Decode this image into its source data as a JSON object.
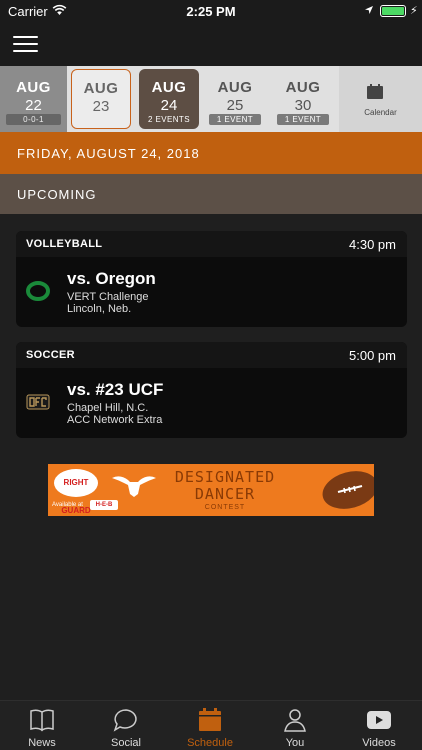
{
  "status_bar": {
    "carrier": "Carrier",
    "time": "2:25 PM",
    "battery_level": 1.0,
    "battery_color": "#4cd964"
  },
  "nav": {
    "menu_icon": "hamburger-menu-icon"
  },
  "date_strip": {
    "days": [
      {
        "month": "AUG",
        "day": "22",
        "tag": "0-0-1",
        "state": "past"
      },
      {
        "month": "AUG",
        "day": "23",
        "tag": "",
        "state": "today"
      },
      {
        "month": "AUG",
        "day": "24",
        "tag": "2 EVENTS",
        "state": "selected"
      },
      {
        "month": "AUG",
        "day": "25",
        "tag": "1 EVENT",
        "state": "upcoming"
      },
      {
        "month": "AUG",
        "day": "30",
        "tag": "1 EVENT",
        "state": "upcoming"
      }
    ],
    "calendar_label": "Calendar",
    "accent_color": "#c0600f"
  },
  "selected_date": "FRIDAY, AUGUST 24, 2018",
  "section_header": "UPCOMING",
  "events": [
    {
      "sport": "VOLLEYBALL",
      "time": "4:30 pm",
      "opponent": "vs. Oregon",
      "line2": "VERT Challenge",
      "line3": "Lincoln, Neb.",
      "logo": "oregon-o-logo",
      "logo_color": "#1a7a3a"
    },
    {
      "sport": "SOCCER",
      "time": "5:00 pm",
      "opponent": "vs. #23 UCF",
      "line2": "Chapel Hill, N.C.",
      "line3": "ACC Network Extra",
      "logo": "ucf-logo",
      "logo_color": "#b9975b"
    }
  ],
  "ad": {
    "brand": "RIGHT GUARD",
    "available": "Available at",
    "store": "H-E-B",
    "title_line1": "DESIGNATED",
    "title_line2": "DANCER",
    "title_line3": "CONTEST"
  },
  "tabs": [
    {
      "label": "News",
      "icon": "book-icon",
      "active": false
    },
    {
      "label": "Social",
      "icon": "chat-bubble-icon",
      "active": false
    },
    {
      "label": "Schedule",
      "icon": "calendar-icon",
      "active": true
    },
    {
      "label": "You",
      "icon": "person-icon",
      "active": false
    },
    {
      "label": "Videos",
      "icon": "play-icon",
      "active": false
    }
  ]
}
